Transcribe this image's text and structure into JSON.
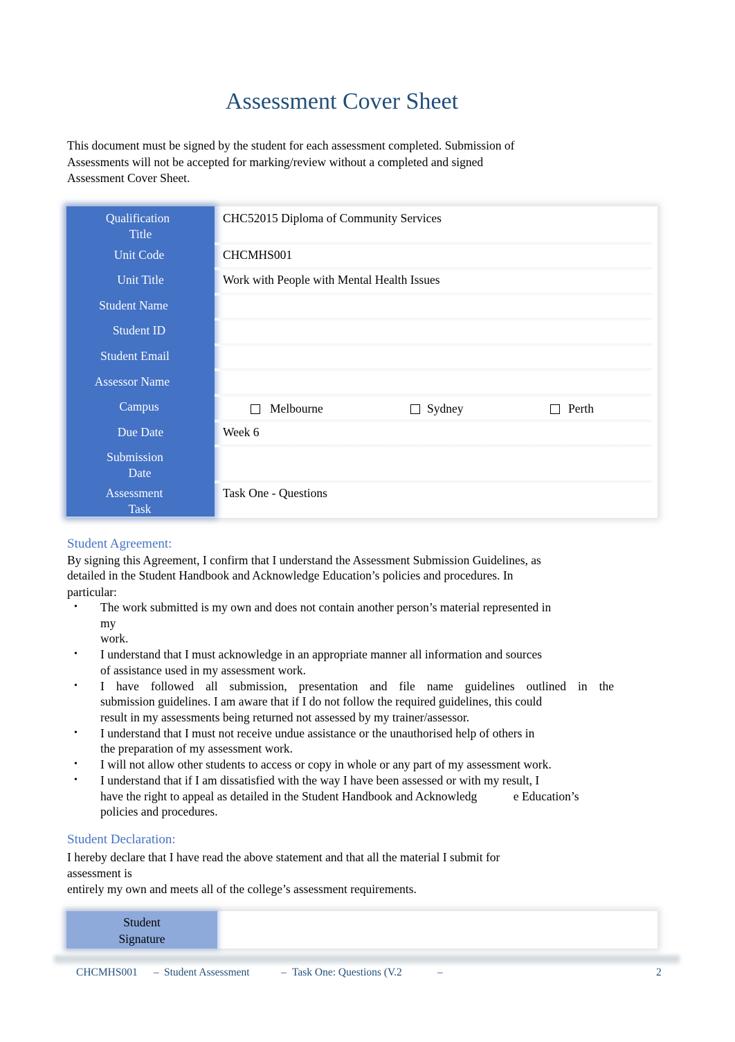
{
  "document": {
    "title": "Assessment Cover Sheet",
    "intro_lines": [
      "This document must be signed by the student for each assessment completed. Submission of",
      "Assessments will not be accepted for marking/review without a completed and signed",
      "Assessment Cover Sheet."
    ]
  },
  "cover_table": {
    "rows": [
      {
        "label_lines": [
          "Qualification",
          "Title"
        ],
        "value": "CHC52015 Diploma of Community Services"
      },
      {
        "label_lines": [
          "Unit Code"
        ],
        "value": "CHCMHS001"
      },
      {
        "label_lines": [
          "Unit Title"
        ],
        "value": "Work with People with Mental Health Issues"
      },
      {
        "label_lines": [
          "Student Name"
        ],
        "value": ""
      },
      {
        "label_lines": [
          "Student ID"
        ],
        "value": ""
      },
      {
        "label_lines": [
          "Student Email"
        ],
        "value": ""
      },
      {
        "label_lines": [
          "Assessor Name"
        ],
        "value": ""
      },
      {
        "label_lines": [
          "Campus"
        ],
        "value": ""
      },
      {
        "label_lines": [
          "Due Date"
        ],
        "value": "Week 6"
      },
      {
        "label_lines": [
          "Submission",
          "Date"
        ],
        "value": ""
      },
      {
        "label_lines": [
          "Assessment",
          "Task"
        ],
        "value": "Task One - Questions"
      }
    ],
    "campus_options": [
      {
        "label": "Melbourne",
        "checked": false,
        "icon": "checkbox-empty-icon"
      },
      {
        "label": "Sydney",
        "checked": false,
        "icon": "checkbox-empty-icon"
      },
      {
        "label": "Perth",
        "checked": false,
        "icon": "checkbox-empty-icon"
      }
    ],
    "label_bg_color": "#4472c4"
  },
  "agreement": {
    "heading": "Student Agreement:",
    "intro_lines": [
      "By signing this Agreement, I confirm that I understand the Assessment Submission Guidelines, as",
      "detailed in the Student Handbook and Acknowledge Education’s policies and procedures. In",
      "particular:"
    ],
    "bullet_icon": "•",
    "bullets": [
      {
        "lines": [
          "The work submitted is my own and does not contain another person’s material represented in",
          "my",
          "work."
        ]
      },
      {
        "lines": [
          "I understand that I must acknowledge in an appropriate manner all information and sources",
          "of assistance used in my assessment work."
        ]
      },
      {
        "lines": [
          "I have followed all submission, presentation and file name guidelines outlined in the",
          "submission guidelines. I am aware that if I do not follow the required guidelines, this could",
          "result in my assessments being returned not assessed by my trainer/assessor."
        ]
      },
      {
        "lines": [
          "I understand that I must not receive undue assistance or the unauthorised help of others in",
          "the preparation of my assessment work."
        ]
      },
      {
        "lines": [
          "I will not allow other students to access or copy in whole or any part of my assessment work."
        ]
      },
      {
        "lines": [
          "I understand that if I am dissatisfied with the way I have been assessed or with my result, I",
          "have the right to appeal as detailed in the Student Handbook and Acknowledg            e Education’s",
          "policies and procedures."
        ]
      }
    ]
  },
  "declaration": {
    "heading": "Student Declaration:",
    "lines": [
      "I hereby declare that I have read the above statement and that all the material I submit for",
      "assessment is",
      "entirely my own and meets all of the college’s assessment requirements."
    ]
  },
  "signature": {
    "label_lines": [
      "Student",
      "Signature"
    ],
    "value": "",
    "label_bg_color": "#8eaadb"
  },
  "footer": {
    "unit_code": "CHCMHS001",
    "sep1": "–",
    "doc_type": "Student Assessment",
    "sep2": "–",
    "task": "Task One: Questions (V.2",
    "sep3": "–",
    "page_number": "2"
  },
  "colors": {
    "title": "#1f4e79",
    "section_heading": "#4472c4",
    "footer_text": "#1f4e79"
  }
}
